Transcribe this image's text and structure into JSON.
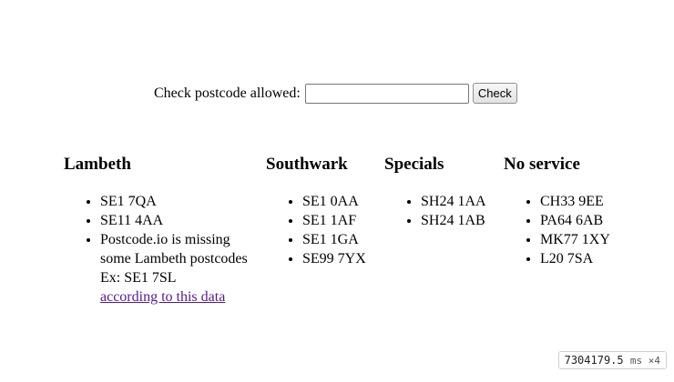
{
  "form": {
    "label": "Check postcode allowed:",
    "input_value": "",
    "button_label": "Check"
  },
  "columns": [
    {
      "heading": "Lambeth",
      "items": [
        "SE1 7QA",
        "SE11 4AA"
      ],
      "note": {
        "line1": "Postcode.io is missing",
        "line2": "some Lambeth postcodes",
        "line3": "Ex: SE1 7SL",
        "link": "according to this data"
      }
    },
    {
      "heading": "Southwark",
      "items": [
        "SE1 0AA",
        "SE1 1AF",
        "SE1 1GA",
        "SE99 7YX"
      ]
    },
    {
      "heading": "Specials",
      "items": [
        "SH24 1AA",
        "SH24 1AB"
      ]
    },
    {
      "heading": "No service",
      "items": [
        "CH33 9EE",
        "PA64 6AB",
        "MK77 1XY",
        "L20 7SA"
      ]
    }
  ],
  "timer": {
    "value": "7304179.5",
    "unit": "ms ×4"
  }
}
